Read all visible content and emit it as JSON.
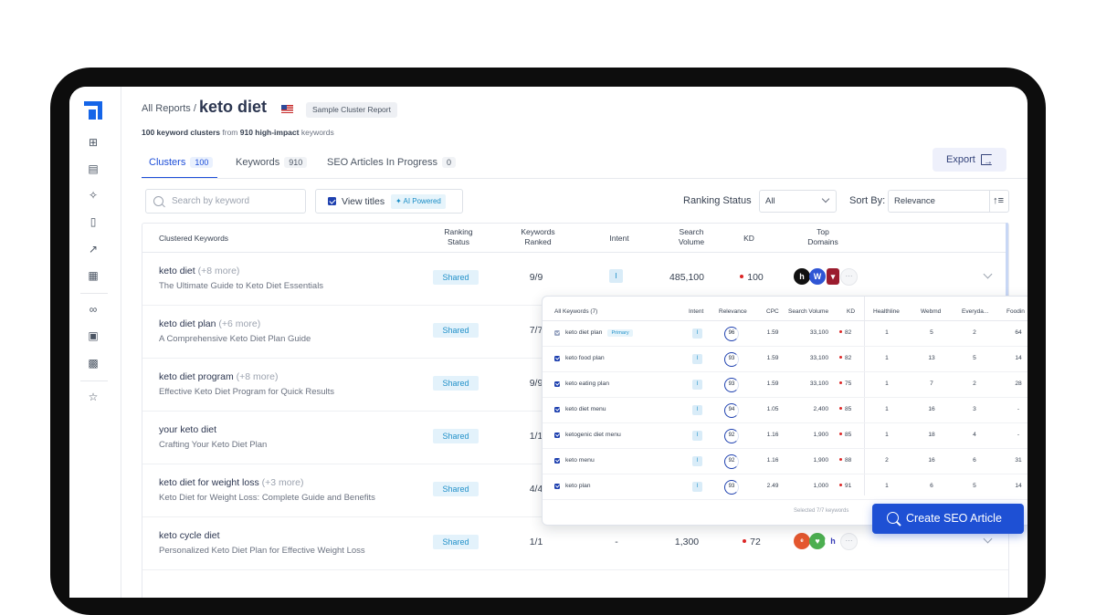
{
  "breadcrumb": {
    "parent": "All Reports /",
    "title": "keto diet"
  },
  "sample_badge": "Sample Cluster Report",
  "summary": {
    "clusters": "100 keyword clusters",
    "from": "from",
    "keywords": "910 high-impact",
    "tail": "keywords"
  },
  "export_label": "Export",
  "tabs": [
    {
      "label": "Clusters",
      "count": "100",
      "active": true
    },
    {
      "label": "Keywords",
      "count": "910",
      "active": false
    },
    {
      "label": "SEO Articles In Progress",
      "count": "0",
      "active": false
    }
  ],
  "search": {
    "placeholder": "Search by keyword"
  },
  "view_titles": {
    "label": "View titles",
    "badge": "AI Powered",
    "checked": true
  },
  "ranking_filter": {
    "label": "Ranking Status",
    "value": "All"
  },
  "sort": {
    "label": "Sort By:",
    "value": "Relevance"
  },
  "columns": {
    "clustered": "Clustered Keywords",
    "ranking_status": [
      "Ranking",
      "Status"
    ],
    "keywords_ranked": [
      "Keywords",
      "Ranked"
    ],
    "intent": "Intent",
    "search_volume": [
      "Search",
      "Volume"
    ],
    "kd": "KD",
    "top_domains": [
      "Top",
      "Domains"
    ]
  },
  "rows": [
    {
      "keyword": "keto diet",
      "more": "(+8 more)",
      "title": "The Ultimate Guide to Keto Diet Essentials",
      "status": "Shared",
      "ranked": "9/9",
      "intent": "I",
      "volume": "485,100",
      "kd": "100"
    },
    {
      "keyword": "keto diet plan",
      "more": "(+6 more)",
      "title": "A Comprehensive Keto Diet Plan Guide",
      "status": "Shared",
      "ranked": "7/7",
      "intent": "",
      "volume": "",
      "kd": ""
    },
    {
      "keyword": "keto diet program",
      "more": "(+8 more)",
      "title": "Effective Keto Diet Program for Quick Results",
      "status": "Shared",
      "ranked": "9/9",
      "intent": "",
      "volume": "",
      "kd": ""
    },
    {
      "keyword": "your keto diet",
      "more": "",
      "title": "Crafting Your Keto Diet Plan",
      "status": "Shared",
      "ranked": "1/1",
      "intent": "",
      "volume": "",
      "kd": ""
    },
    {
      "keyword": "keto diet for weight loss",
      "more": "(+3 more)",
      "title": "Keto Diet for Weight Loss: Complete Guide and Benefits",
      "status": "Shared",
      "ranked": "4/4",
      "intent": "",
      "volume": "",
      "kd": ""
    },
    {
      "keyword": "keto cycle diet",
      "more": "",
      "title": "Personalized Keto Diet Plan for Effective Weight Loss",
      "status": "Shared",
      "ranked": "1/1",
      "intent": "-",
      "volume": "1,300",
      "kd": "72"
    }
  ],
  "row1_domains": [
    {
      "icon": "healthline-icon",
      "glyph": "h",
      "color": "#111111"
    },
    {
      "icon": "webmd-icon",
      "glyph": "W",
      "color": "#2f55d4"
    },
    {
      "icon": "harvard-shield-icon",
      "glyph": "▼",
      "color": "#9b1c2e"
    }
  ],
  "row6_domains": [
    {
      "icon": "everyday-health-icon",
      "glyph": "e",
      "color": "#e4572e"
    },
    {
      "icon": "apple-heart-icon",
      "glyph": "♥",
      "color": "#4caf50"
    },
    {
      "icon": "healthline-icon",
      "glyph": "h",
      "color": "#ffffff"
    }
  ],
  "popup": {
    "headers": {
      "all": "All Keywords (7)",
      "intent": "Intent",
      "relevance": "Relevance",
      "cpc": "CPC",
      "volume": "Search Volume",
      "kd": "KD",
      "d1": "Healthline",
      "d2": "Webmd",
      "d3": "Everyda...",
      "d4": "Foodin"
    },
    "primary_label": "Primary",
    "keywords": [
      {
        "kw": "keto diet plan",
        "primary": true,
        "intent": "I",
        "rel": "96",
        "cpc": "1.59",
        "vol": "33,100",
        "kd": "82",
        "d1": "1",
        "d2": "5",
        "d3": "2",
        "d4": "64"
      },
      {
        "kw": "keto food plan",
        "primary": false,
        "intent": "I",
        "rel": "93",
        "cpc": "1.59",
        "vol": "33,100",
        "kd": "82",
        "d1": "1",
        "d2": "13",
        "d3": "5",
        "d4": "14"
      },
      {
        "kw": "keto eating plan",
        "primary": false,
        "intent": "I",
        "rel": "93",
        "cpc": "1.59",
        "vol": "33,100",
        "kd": "75",
        "d1": "1",
        "d2": "7",
        "d3": "2",
        "d4": "28"
      },
      {
        "kw": "keto diet menu",
        "primary": false,
        "intent": "I",
        "rel": "94",
        "cpc": "1.05",
        "vol": "2,400",
        "kd": "85",
        "d1": "1",
        "d2": "16",
        "d3": "3",
        "d4": "-"
      },
      {
        "kw": "ketogenic diet menu",
        "primary": false,
        "intent": "I",
        "rel": "92",
        "cpc": "1.16",
        "vol": "1,900",
        "kd": "85",
        "d1": "1",
        "d2": "18",
        "d3": "4",
        "d4": "-"
      },
      {
        "kw": "keto menu",
        "primary": false,
        "intent": "I",
        "rel": "92",
        "cpc": "1.16",
        "vol": "1,900",
        "kd": "88",
        "d1": "2",
        "d2": "16",
        "d3": "6",
        "d4": "31"
      },
      {
        "kw": "keto plan",
        "primary": false,
        "intent": "I",
        "rel": "93",
        "cpc": "2.49",
        "vol": "1,000",
        "kd": "91",
        "d1": "1",
        "d2": "6",
        "d3": "5",
        "d4": "14"
      }
    ],
    "footer": "Selected 7/7 keywords"
  },
  "cta_label": "Create SEO Article",
  "colors": {
    "accent": "#1e50d4",
    "status_bg": "#e3f2fb",
    "kd_dot": "#dc2626"
  }
}
